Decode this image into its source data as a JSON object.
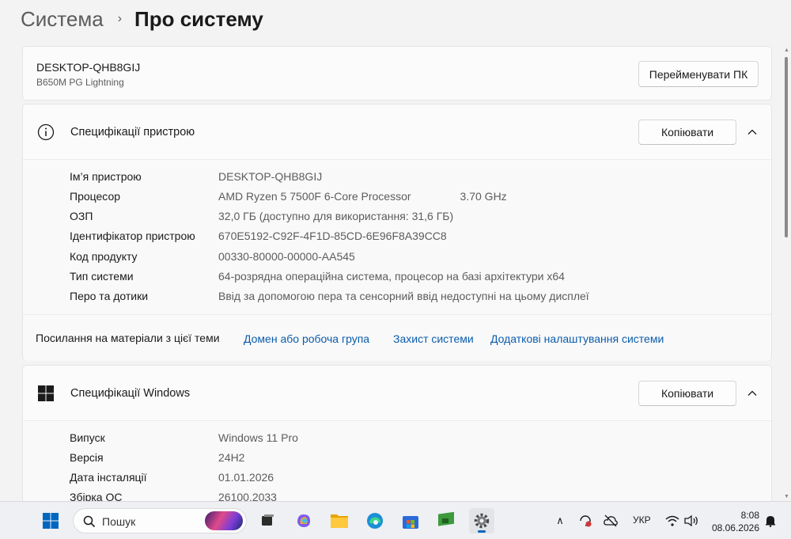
{
  "breadcrumb": {
    "parent": "Система",
    "separator": "›",
    "current": "Про систему"
  },
  "device_card": {
    "name": "DESKTOP-QHB8GIJ",
    "model": "B650M PG Lightning",
    "rename_button": "Перейменувати ПК"
  },
  "device_specs": {
    "title": "Специфікації пристрою",
    "copy_button": "Копіювати",
    "rows": [
      {
        "label": "Ім’я пристрою",
        "value": "DESKTOP-QHB8GIJ",
        "extra": ""
      },
      {
        "label": "Процесор",
        "value": "AMD Ryzen 5 7500F 6-Core Processor",
        "extra": "3.70 GHz"
      },
      {
        "label": "ОЗП",
        "value": "32,0 ГБ (доступно для використання: 31,6 ГБ)",
        "extra": ""
      },
      {
        "label": "Ідентифікатор пристрою",
        "value": "670E5192-C92F-4F1D-85CD-6E96F8A39CC8",
        "extra": ""
      },
      {
        "label": "Код продукту",
        "value": "00330-80000-00000-AA545",
        "extra": ""
      },
      {
        "label": "Тип системи",
        "value": "64-розрядна операційна система, процесор на базі архітектури x64",
        "extra": ""
      },
      {
        "label": "Перо та дотики",
        "value": "Ввід за допомогою пера та сенсорний ввід недоступні на цьому дисплеї",
        "extra": ""
      }
    ]
  },
  "related_links": {
    "label": "Посилання на матеріали з цієї теми",
    "links": [
      "Домен або робоча група",
      "Захист системи",
      "Додаткові налаштування системи"
    ]
  },
  "windows_specs": {
    "title": "Специфікації Windows",
    "copy_button": "Копіювати",
    "rows": [
      {
        "label": "Випуск",
        "value": "Windows 11 Pro"
      },
      {
        "label": "Версія",
        "value": "24H2"
      },
      {
        "label": "Дата інсталяції",
        "value": "01.01.2026"
      },
      {
        "label": "Збірка ОС",
        "value": "26100.2033"
      }
    ]
  },
  "taskbar": {
    "search_placeholder": "Пошук",
    "language": "УКР",
    "time": "8:08",
    "date": "08.06.2026",
    "accent_color": "#0067c0"
  }
}
